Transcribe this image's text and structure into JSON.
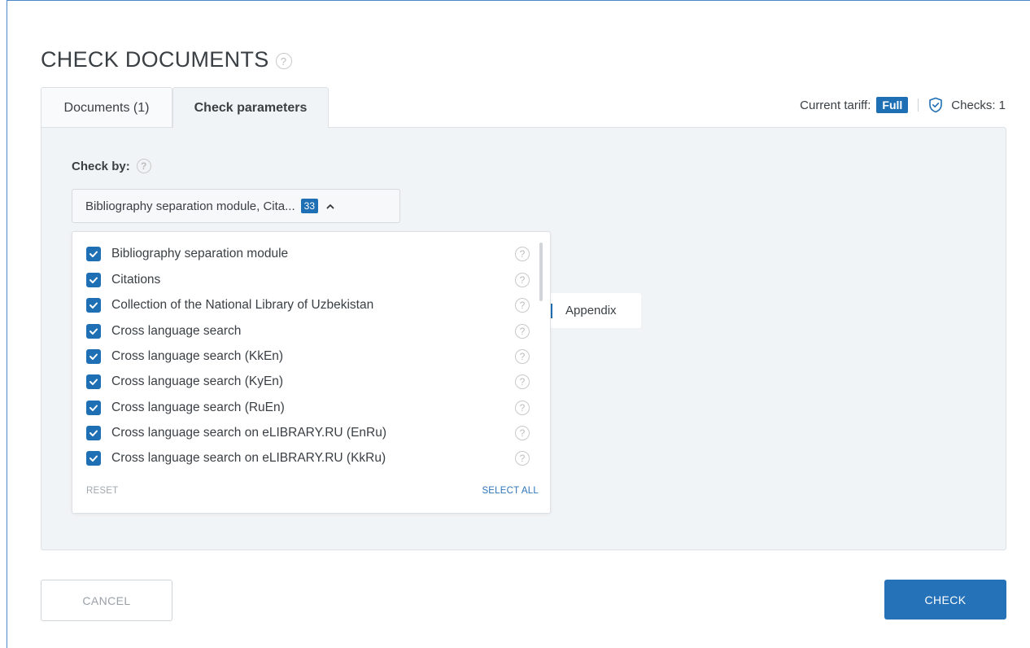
{
  "header": {
    "title": "CHECK DOCUMENTS",
    "help_glyph": "?"
  },
  "tabs": [
    {
      "label": "Documents (1)"
    },
    {
      "label": "Check parameters"
    }
  ],
  "tariff": {
    "label": "Current tariff:",
    "value": "Full",
    "checks_label": "Checks: 1"
  },
  "check_by": {
    "label": "Check by:",
    "selected_summary": "Bibliography separation module, Cita...",
    "selected_count": "33",
    "chevron": "^"
  },
  "modules": [
    {
      "label": "Bibliography separation module",
      "checked": true
    },
    {
      "label": "Citations",
      "checked": true
    },
    {
      "label": "Collection of the National Library of Uzbekistan",
      "checked": true
    },
    {
      "label": "Cross language search",
      "checked": true
    },
    {
      "label": "Cross language search (KkEn)",
      "checked": true
    },
    {
      "label": "Cross language search (KyEn)",
      "checked": true
    },
    {
      "label": "Cross language search (RuEn)",
      "checked": true
    },
    {
      "label": "Cross language search on eLIBRARY.RU (EnRu)",
      "checked": true
    },
    {
      "label": "Cross language search on eLIBRARY.RU (KkRu)",
      "checked": true
    }
  ],
  "dropdown_actions": {
    "reset": "RESET",
    "select_all": "SELECT ALL"
  },
  "appendix_chip": "Appendix",
  "footer": {
    "cancel": "CANCEL",
    "check": "CHECK"
  },
  "colors": {
    "accent": "#1f6fb5",
    "panel_bg": "#f1f4f6",
    "border": "#dde1e5"
  },
  "icons": {
    "help": "help-circle-icon",
    "checks": "shield-check-icon",
    "checkbox": "checkbox-checked-icon",
    "chevron": "chevron-up-icon"
  }
}
